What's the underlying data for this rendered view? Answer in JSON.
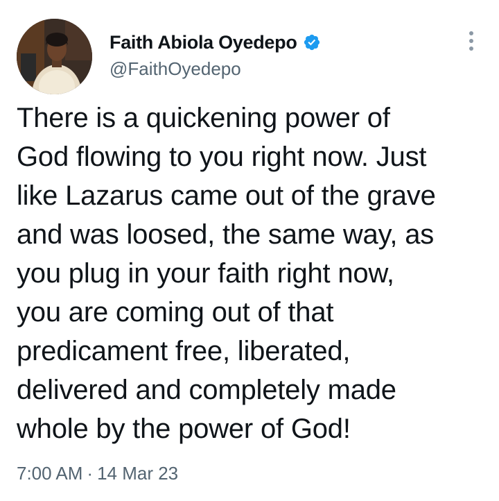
{
  "author": {
    "display_name": "Faith Abiola Oyedepo",
    "handle": "@FaithOyedepo",
    "verified_icon": "verified-badge-icon",
    "avatar_icon": "profile-photo"
  },
  "tweet": {
    "lines": [
      "There is a quickening power of",
      "God flowing to you right now. Just",
      "like Lazarus came out of the grave",
      "and was loosed, the same way, as",
      "you plug in your faith right now,",
      "you are coming out of that",
      "predicament free, liberated,",
      "delivered and completely made",
      "whole by the power of God!"
    ]
  },
  "meta": {
    "time": "7:00 AM",
    "separator": "·",
    "date": "14 Mar 23"
  },
  "colors": {
    "text": "#0f1419",
    "secondary": "#536471",
    "verified": "#1d9bf0",
    "background": "#ffffff"
  }
}
